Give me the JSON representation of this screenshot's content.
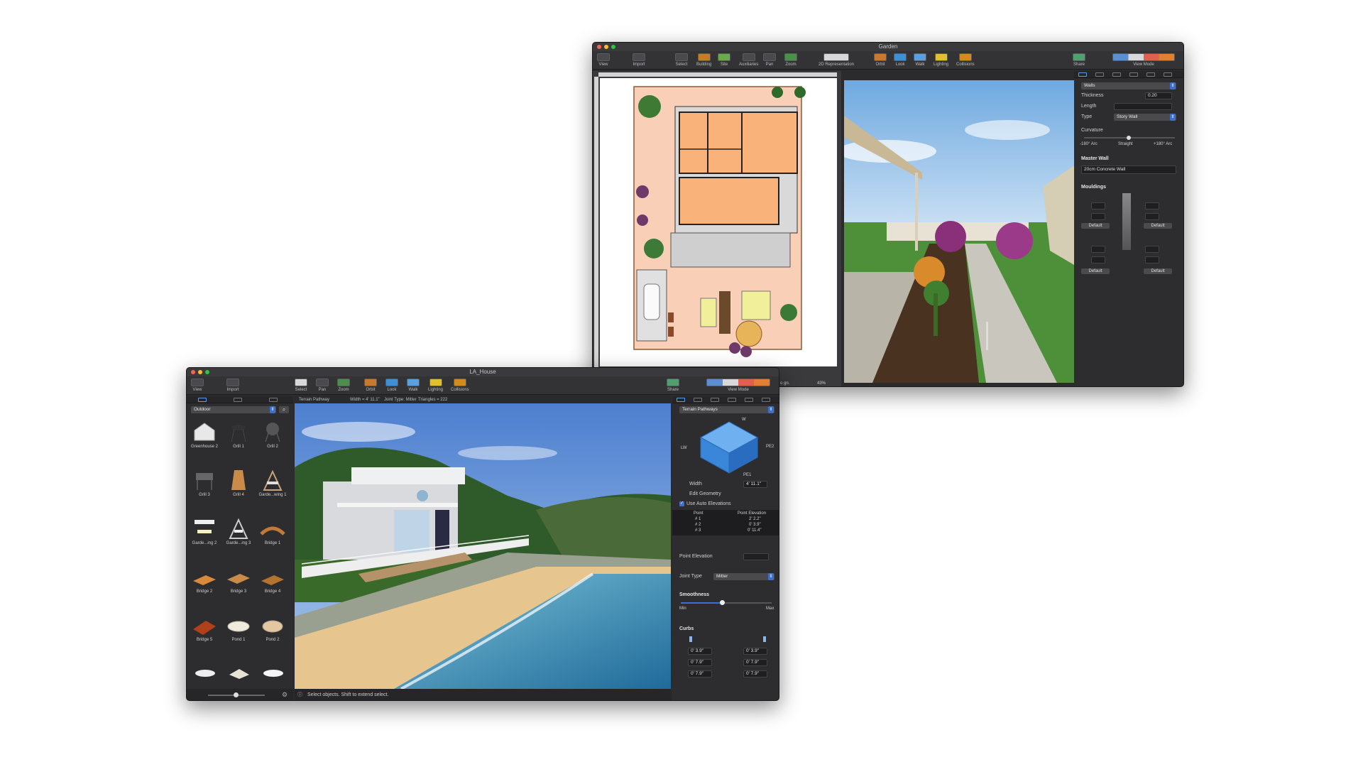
{
  "garden_window": {
    "title": "Garden",
    "toolbar": {
      "view": "View",
      "import": "Import",
      "select": "Select",
      "building": "Building",
      "site": "Site",
      "auxiliaries": "Auxiliaries",
      "pan": "Pan",
      "zoom": "Zoom",
      "representation": "2D Representation",
      "orbit": "Orbit",
      "look": "Look",
      "walk": "Walk",
      "lighting": "Lighting",
      "collisions": "Collisions",
      "share": "Share",
      "view_mode": "View Mode"
    },
    "plan_zoom": "43%",
    "plan_status": "o gn.",
    "inspector": {
      "object_type": "Walls",
      "thickness_label": "Thickness",
      "thickness_value": "0.20",
      "length_label": "Length",
      "type_label": "Type",
      "type_value": "Story Wall",
      "curvature_label": "Curvature",
      "curv_left": "-180° Arc",
      "curv_mid": "Straight",
      "curv_right": "+180° Arc",
      "master_wall_label": "Master Wall",
      "master_wall_value": "20cm Concrete Wall",
      "mouldings_label": "Mouldings",
      "default_1": "Default",
      "default_2": "Default",
      "default_3": "Default",
      "default_4": "Default"
    }
  },
  "house_window": {
    "title": "LA_House",
    "toolbar": {
      "view": "View",
      "import": "Import",
      "select": "Select",
      "pan": "Pan",
      "zoom": "Zoom",
      "orbit": "Orbit",
      "look": "Look",
      "walk": "Walk",
      "lighting": "Lighting",
      "collisions": "Collisions",
      "share": "Share",
      "view_mode": "View Mode"
    },
    "library": {
      "category": "Outdoor",
      "items": [
        "Greenhouse 2",
        "Grill 1",
        "Grill 2",
        "Grill 3",
        "Grill 4",
        "Garde...wing 1",
        "Garde...ing 2",
        "Garde...ing 3",
        "Bridge 1",
        "Bridge 2",
        "Bridge 3",
        "Bridge 4",
        "Bridge 5",
        "Pond 1",
        "Pond 2"
      ]
    },
    "info_bar": {
      "object": "Terrain Pathway",
      "width": "Width = 4' 11.1\"",
      "joint": "Joint Type: Mitter",
      "triangles": "Triangles = 222"
    },
    "status": "Select objects. Shift to extend select.",
    "inspector": {
      "object_type": "Terrain Pathways",
      "diagram_w": "W",
      "diagram_pe2": "PE2",
      "diagram_pe1": "PE1",
      "diagram_lw": "LW",
      "width_label": "Width",
      "width_value": "4' 11.1\"",
      "edit_geometry": "Edit Geometry",
      "auto_elev": "Use Auto Elevations",
      "table_headers": [
        "Point",
        "Point Elevation"
      ],
      "table_rows": [
        [
          "# 1",
          "2' 2.2\""
        ],
        [
          "# 2",
          "0' 3.9\""
        ],
        [
          "# 3",
          "0' 11.4\""
        ]
      ],
      "point_elevation_label": "Point Elevation",
      "joint_type_label": "Joint Type",
      "joint_type_value": "Mitter",
      "smoothness_label": "Smoothness",
      "smooth_min": "Min",
      "smooth_max": "Max",
      "smoothness": 0.45,
      "curbs_label": "Curbs",
      "curb_w_left": "0' 3.9\"",
      "curb_w_right": "0' 3.9\"",
      "curb_h_left": "0' 7.9\"",
      "curb_h_right": "0' 7.9\"",
      "curb_d_left": "0' 7.9\"",
      "curb_d_right": "0' 7.9\""
    }
  },
  "colors": {
    "accent": "#3b6fd0",
    "room_fill": "#f8b27a",
    "sand": "#e7c48f",
    "water": "#3e8fb8"
  }
}
